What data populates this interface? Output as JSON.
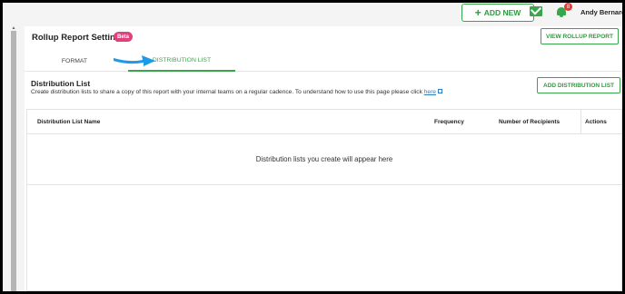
{
  "topbar": {
    "add_new_label": "ADD NEW",
    "add_new_icon": "plus-icon",
    "mail_icon": "mail-icon",
    "bell_icon": "bell-icon",
    "notification_count": "8",
    "user_name": "Andy Bernard"
  },
  "page": {
    "title": "Rollup Report Settings",
    "beta_label": "Beta",
    "view_rollup_label": "VIEW ROLLUP REPORT"
  },
  "tabs": [
    {
      "label": "FORMAT",
      "active": false
    },
    {
      "label": "DISTRIBUTION LIST",
      "active": true
    }
  ],
  "section": {
    "title": "Distribution List",
    "description": "Create distribution lists to share a copy of this report with your internal teams on a regular cadence. To understand how to use this page please click",
    "link_text": "here",
    "add_button_label": "ADD DISTRIBUTION LIST"
  },
  "table": {
    "columns": [
      "Distribution List Name",
      "Frequency",
      "Number of Recipients",
      "Actions"
    ],
    "empty_message": "Distribution lists you create will appear here"
  },
  "colors": {
    "accent_green": "#3aa64b",
    "beta_pink": "#e2407c",
    "badge_red": "#e53935",
    "arrow_blue": "#1e9be8",
    "link_blue": "#2b7bc4"
  }
}
